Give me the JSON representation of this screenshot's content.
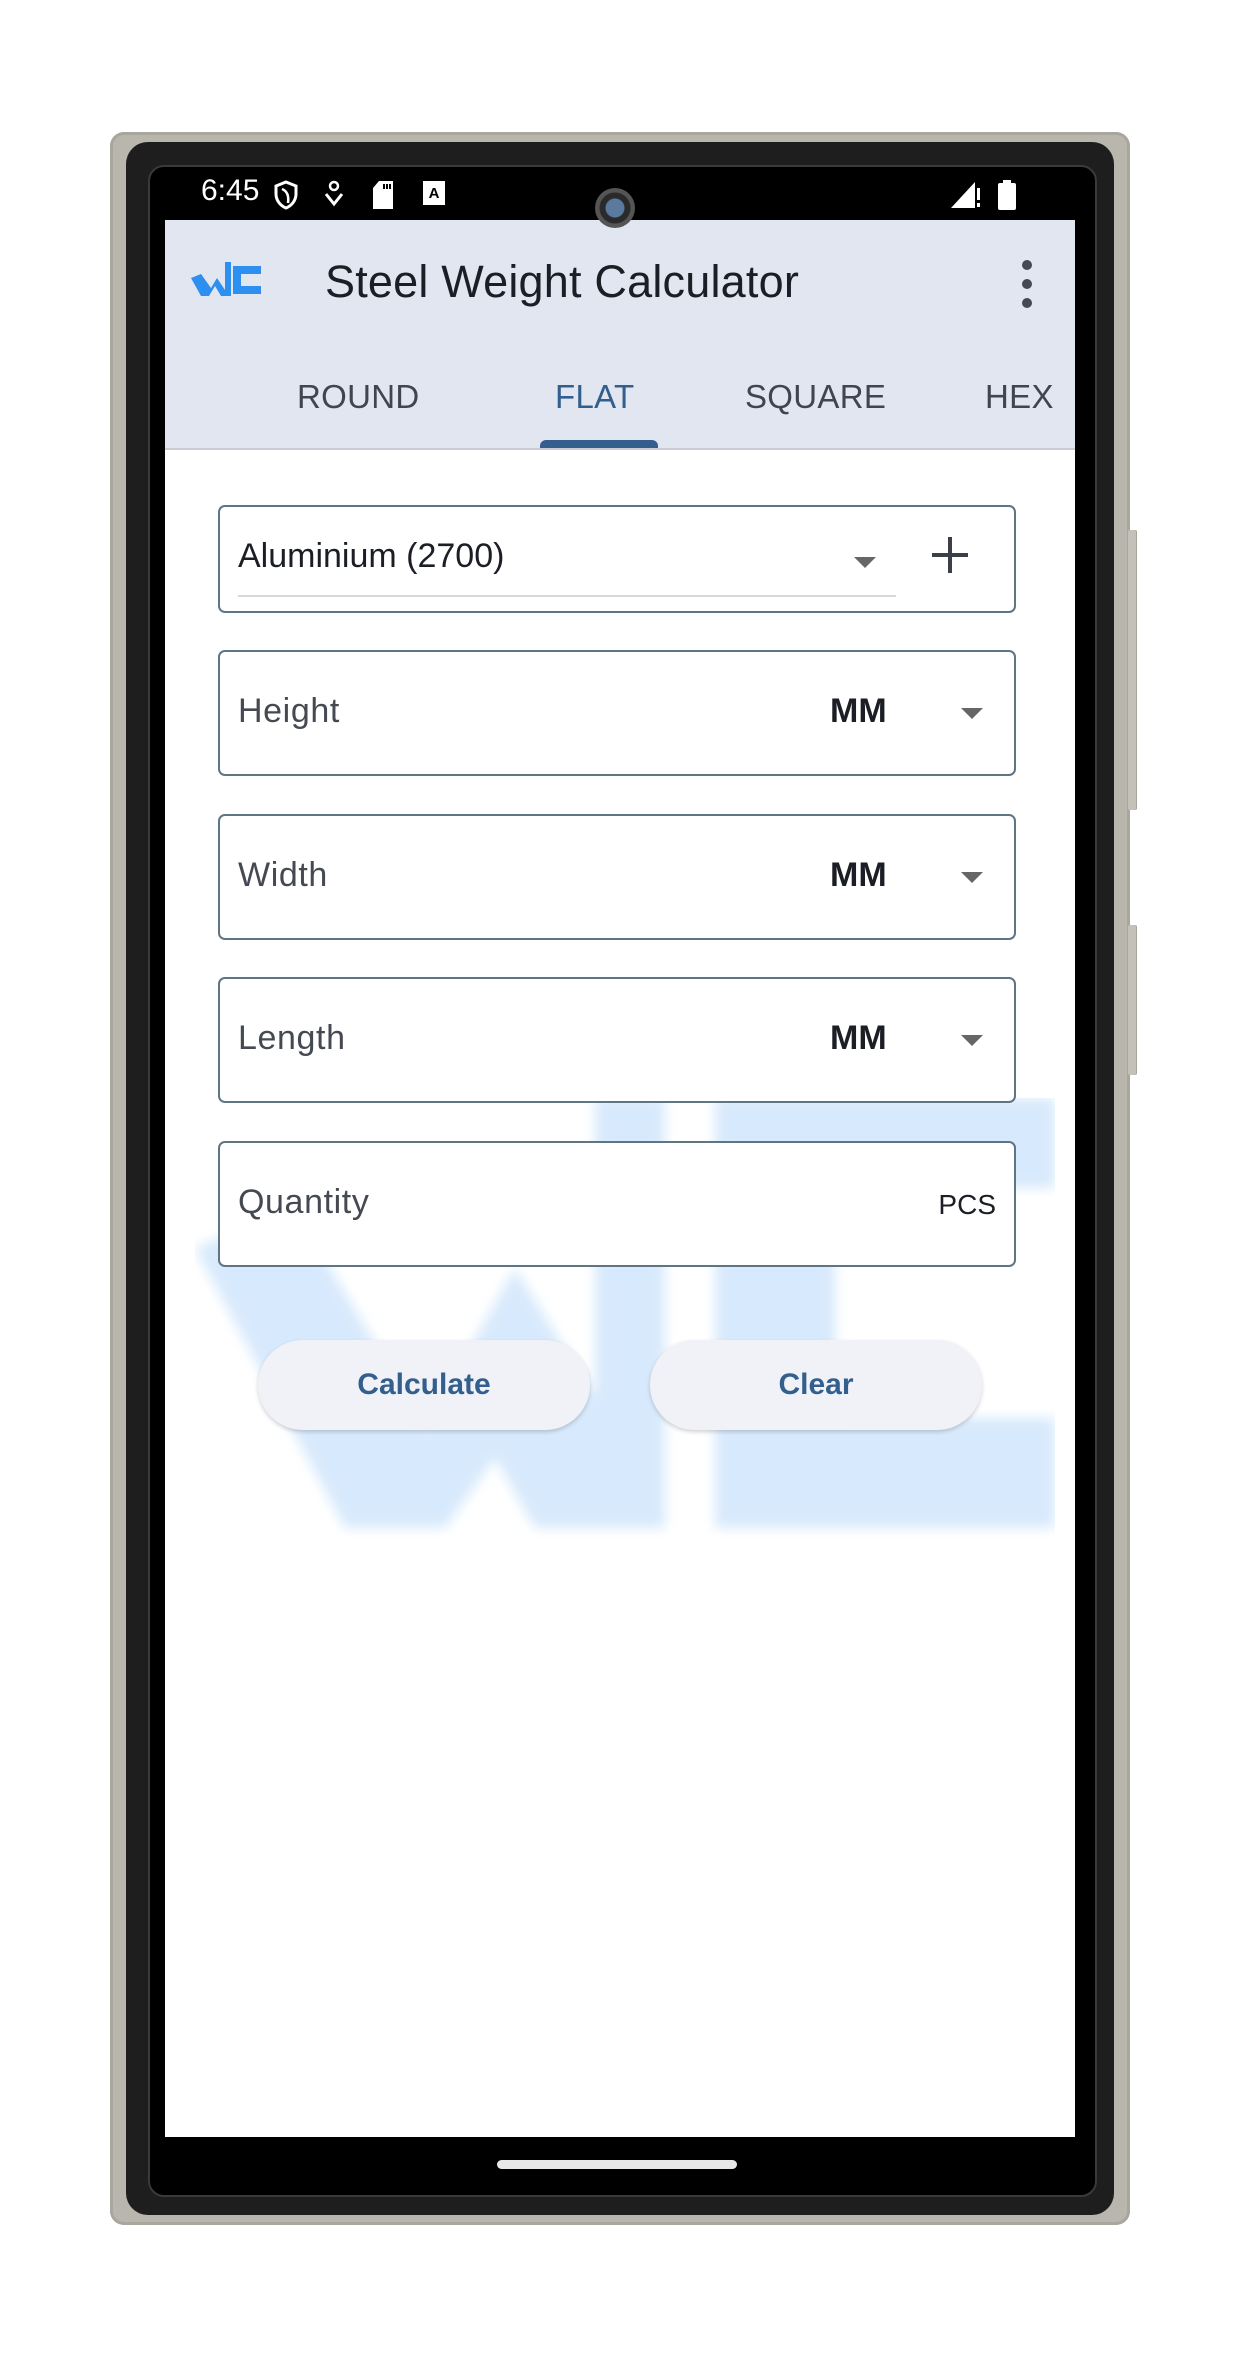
{
  "status_bar": {
    "time": "6:45",
    "left_icons": [
      "shield-icon",
      "accessibility-heart-icon",
      "sd-card-icon",
      "font-a-icon"
    ],
    "right_icons": [
      "signal-no-data-icon",
      "battery-full-icon"
    ]
  },
  "app_bar": {
    "title": "Steel Weight Calculator",
    "logo": "WC",
    "more_menu": "more-vert-icon"
  },
  "tabs": [
    {
      "label": "ROUND",
      "active": false
    },
    {
      "label": "FLAT",
      "active": true
    },
    {
      "label": "SQUARE",
      "active": false
    },
    {
      "label": "HEX",
      "active": false
    }
  ],
  "form": {
    "material": {
      "selected": "Aluminium (2700)",
      "add_icon": "plus-icon"
    },
    "fields": [
      {
        "label": "Height",
        "unit": "MM"
      },
      {
        "label": "Width",
        "unit": "MM"
      },
      {
        "label": "Length",
        "unit": "MM"
      },
      {
        "label": "Quantity",
        "suffix": "PCS"
      }
    ]
  },
  "buttons": {
    "calculate": "Calculate",
    "clear": "Clear"
  },
  "colors": {
    "accent": "#335f8f",
    "app_bar_bg": "#e1e6f0",
    "logo_blue": "#2d8ff0",
    "watermark": "#d5e8fc"
  }
}
